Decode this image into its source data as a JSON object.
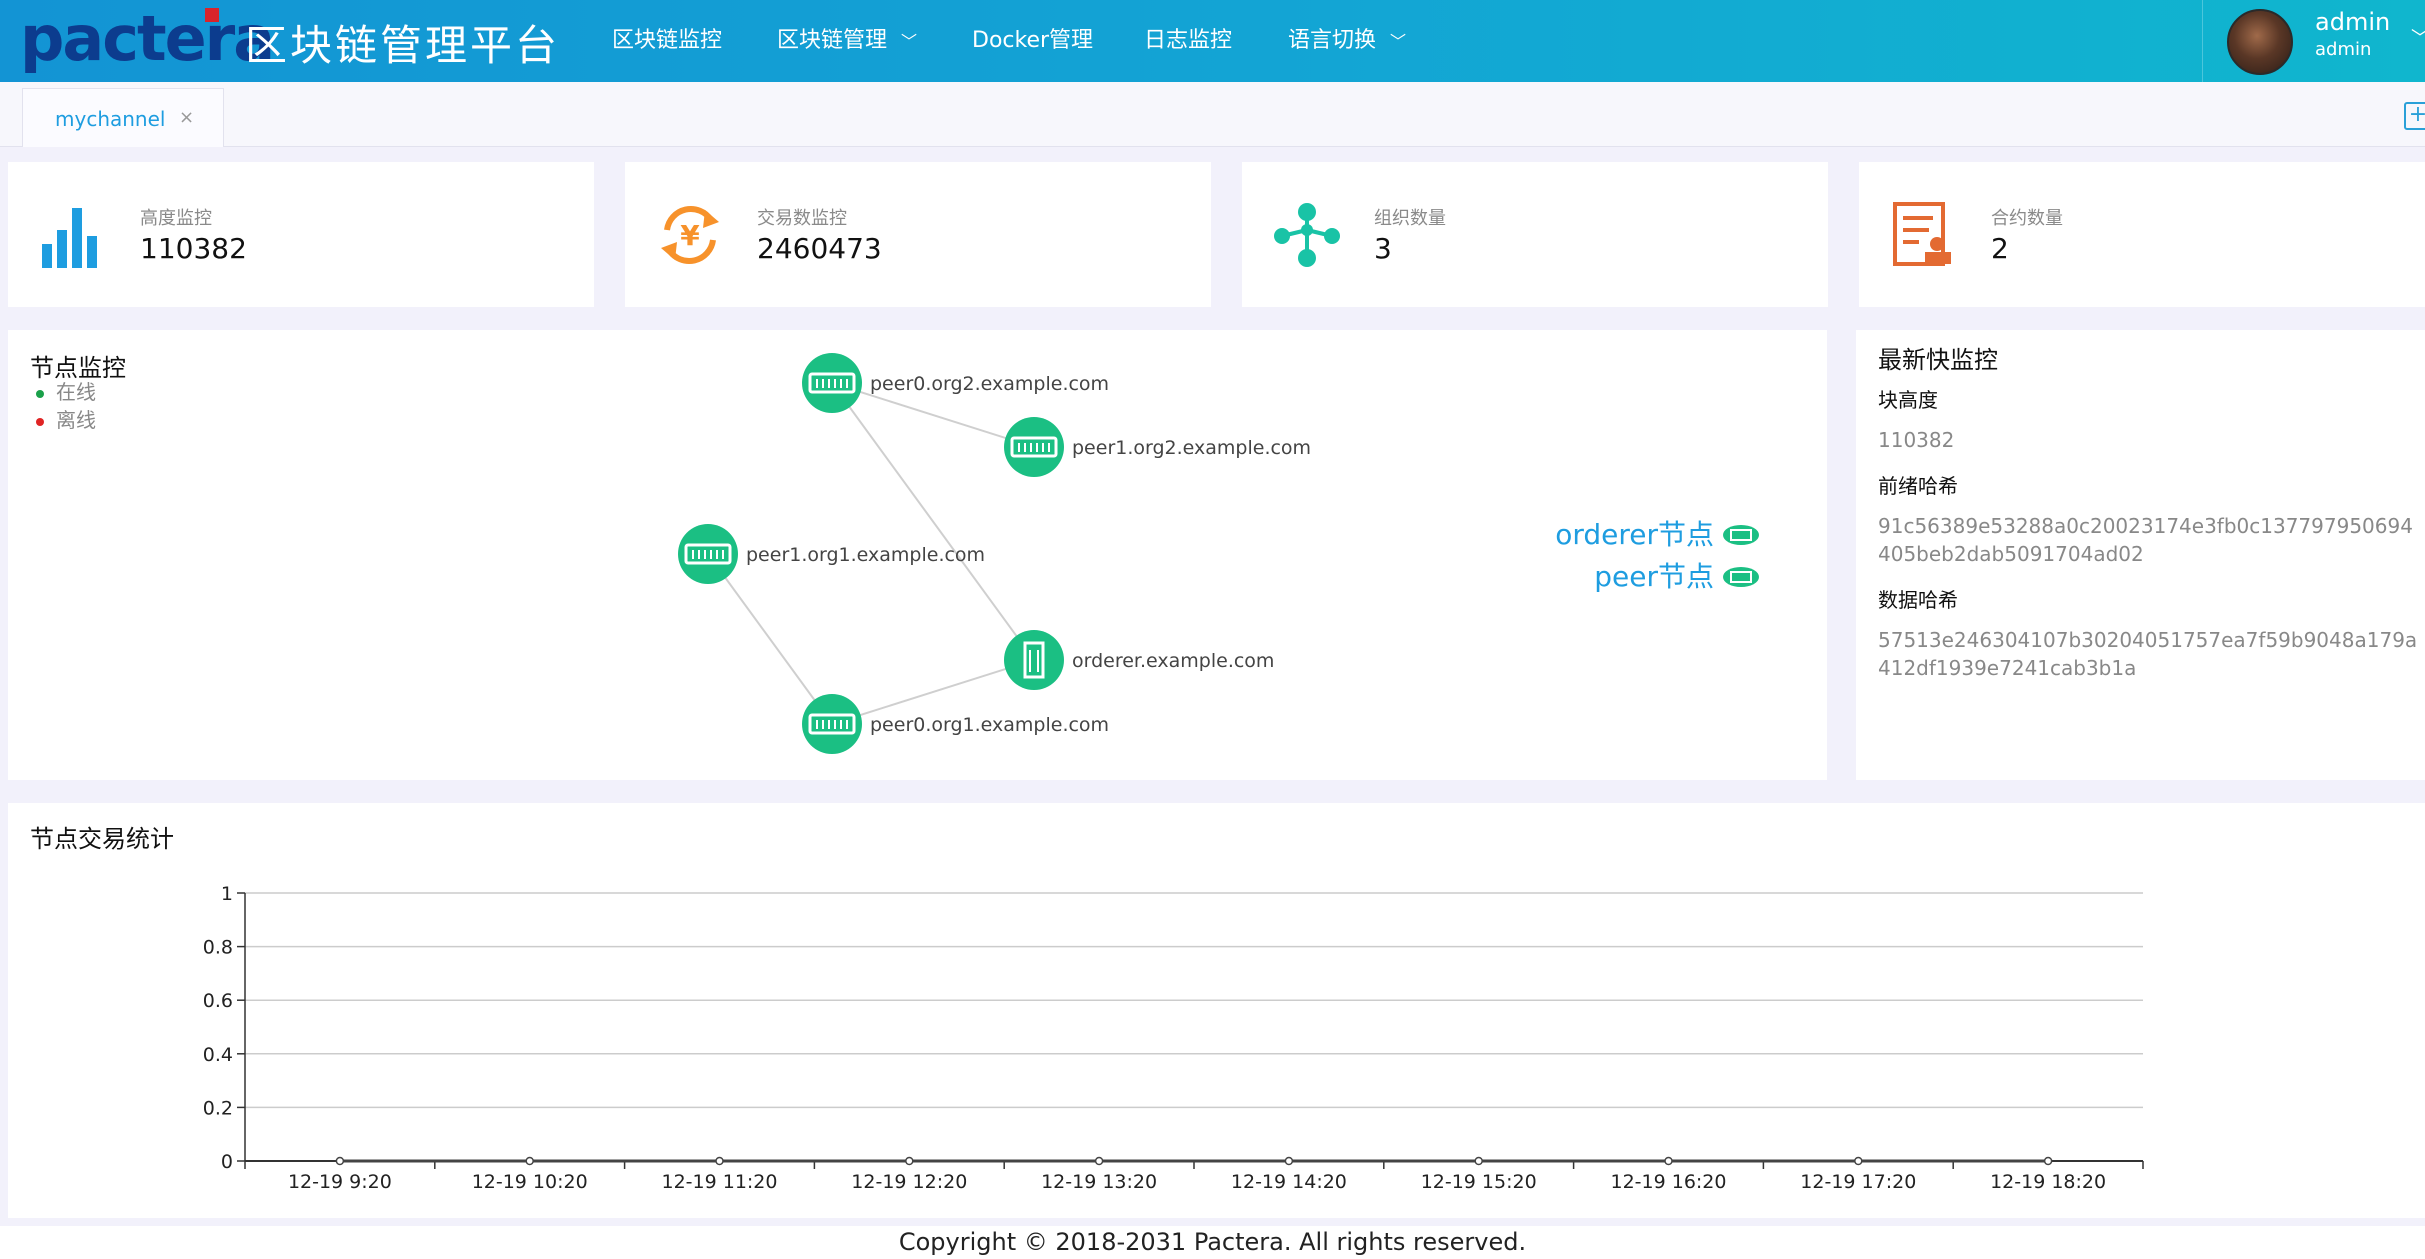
{
  "header": {
    "logo": "pactera",
    "app_title": "区块链管理平台",
    "nav": [
      {
        "label": "区块链监控",
        "has_dropdown": false
      },
      {
        "label": "区块链管理",
        "has_dropdown": true
      },
      {
        "label": "Docker管理",
        "has_dropdown": false
      },
      {
        "label": "日志监控",
        "has_dropdown": false
      },
      {
        "label": "语言切换",
        "has_dropdown": true
      }
    ],
    "user": {
      "name": "admin",
      "role": "admin"
    }
  },
  "tabs": [
    {
      "label": "mychannel",
      "close": "×",
      "active": true
    }
  ],
  "stats": [
    {
      "label": "高度监控",
      "value": "110382",
      "icon": "bar-chart-icon",
      "color": "#1e9de0"
    },
    {
      "label": "交易数监控",
      "value": "2460473",
      "icon": "yuan-exchange-icon",
      "color": "#f7922b"
    },
    {
      "label": "组织数量",
      "value": "3",
      "icon": "organization-network-icon",
      "color": "#19c3a6"
    },
    {
      "label": "合约数量",
      "value": "2",
      "icon": "contract-document-icon",
      "color": "#e36a32"
    }
  ],
  "node_monitor": {
    "title": "节点监控",
    "legend": [
      {
        "label": "在线",
        "color": "#1aa04a"
      },
      {
        "label": "离线",
        "color": "#e02424"
      }
    ],
    "nodes": [
      {
        "id": "peer0.org2.example.com",
        "type": "peer",
        "status": "online"
      },
      {
        "id": "peer1.org2.example.com",
        "type": "peer",
        "status": "online"
      },
      {
        "id": "peer1.org1.example.com",
        "type": "peer",
        "status": "online"
      },
      {
        "id": "orderer.example.com",
        "type": "orderer",
        "status": "online"
      },
      {
        "id": "peer0.org1.example.com",
        "type": "peer",
        "status": "online"
      }
    ],
    "links": [
      [
        "peer0.org2.example.com",
        "peer1.org2.example.com"
      ],
      [
        "peer0.org2.example.com",
        "orderer.example.com"
      ],
      [
        "peer1.org1.example.com",
        "peer0.org1.example.com"
      ],
      [
        "peer0.org1.example.com",
        "orderer.example.com"
      ]
    ],
    "type_legend": [
      {
        "label": "orderer节点",
        "icon": "orderer-icon"
      },
      {
        "label": "peer节点",
        "icon": "peer-icon"
      }
    ],
    "node_color": "#1bbf83",
    "orderer_label_color": "#d42a1f"
  },
  "latest_block": {
    "title": "最新快监控",
    "height_label": "块高度",
    "height_value": "110382",
    "prev_hash_label": "前绪哈希",
    "prev_hash_value": "91c56389e53288a0c20023174e3fb0c137797950694405beb2dab5091704ad02",
    "data_hash_label": "数据哈希",
    "data_hash_value": "57513e246304107b30204051757ea7f59b9048a179a412df1939e7241cab3b1a"
  },
  "tx_stats": {
    "title": "节点交易统计"
  },
  "chart_data": {
    "type": "line",
    "title": "节点交易统计",
    "categories": [
      "12-19 9:20",
      "12-19 10:20",
      "12-19 11:20",
      "12-19 12:20",
      "12-19 13:20",
      "12-19 14:20",
      "12-19 15:20",
      "12-19 16:20",
      "12-19 17:20",
      "12-19 18:20"
    ],
    "series": [
      {
        "values": [
          0,
          0,
          0,
          0,
          0,
          0,
          0,
          0,
          0,
          0
        ]
      }
    ],
    "y_ticks": [
      "0",
      "0.2",
      "0.4",
      "0.6",
      "0.8",
      "1"
    ],
    "ylim": [
      0,
      1
    ],
    "grid": true
  },
  "footer": {
    "copyright": "Copyright © 2018-2031 Pactera. All rights reserved."
  }
}
